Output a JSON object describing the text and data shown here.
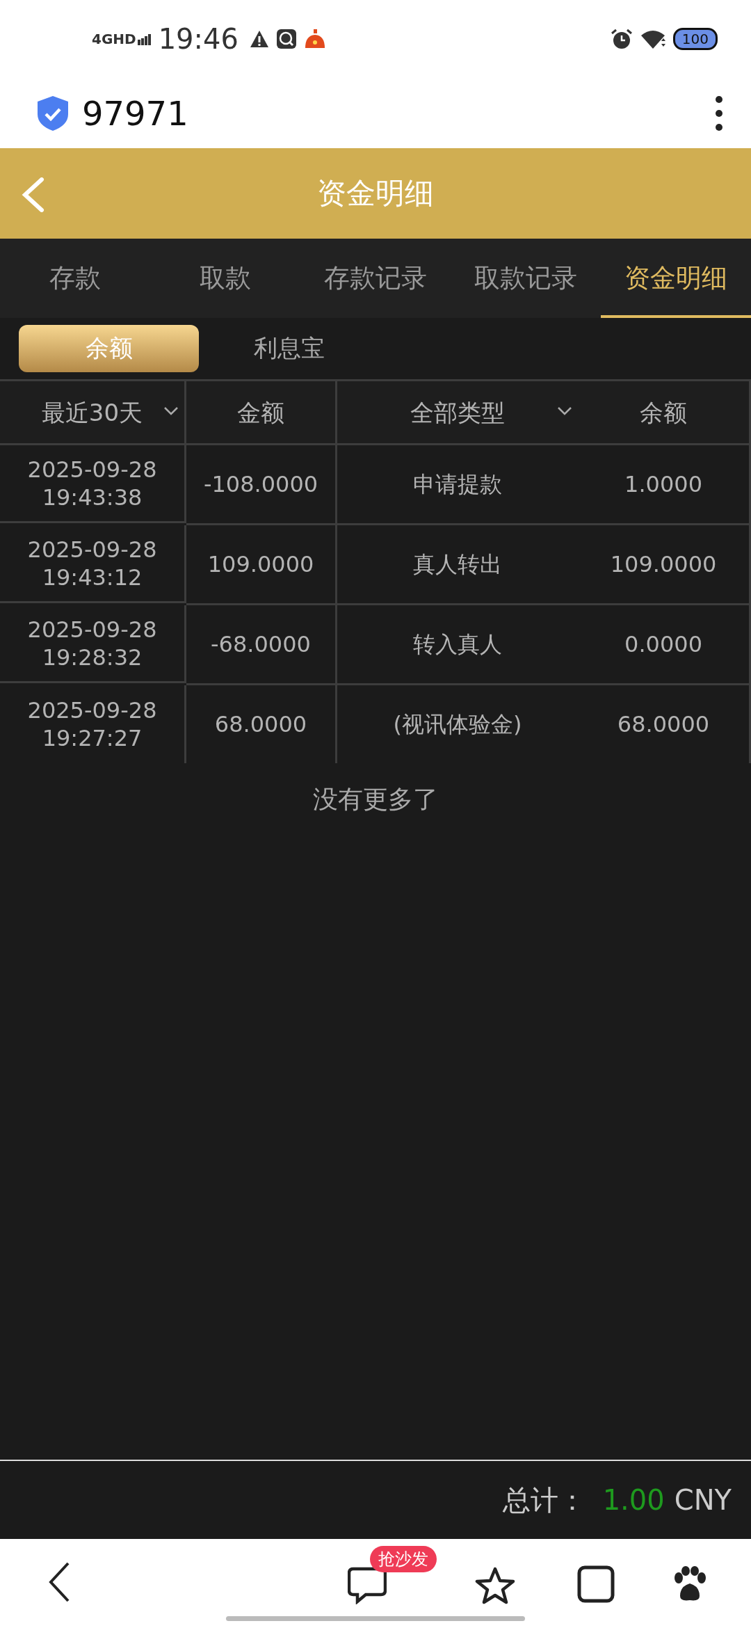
{
  "status_bar": {
    "network": "4GHD",
    "time": "19:46",
    "battery": "100"
  },
  "address_bar": {
    "title": "97971"
  },
  "header": {
    "title": "资金明细"
  },
  "tabs": [
    {
      "label": "存款",
      "selected": false
    },
    {
      "label": "取款",
      "selected": false
    },
    {
      "label": "存款记录",
      "selected": false
    },
    {
      "label": "取款记录",
      "selected": false
    },
    {
      "label": "资金明细",
      "selected": true
    }
  ],
  "sub_tabs": [
    {
      "label": "余额",
      "selected": true
    },
    {
      "label": "利息宝",
      "selected": false
    }
  ],
  "table": {
    "columns": [
      {
        "label": "最近30天",
        "dropdown": true
      },
      {
        "label": "金额",
        "dropdown": false
      },
      {
        "label": "全部类型",
        "dropdown": true
      },
      {
        "label": "余额",
        "dropdown": false
      }
    ],
    "rows": [
      {
        "datetime": "2025-09-28 19:43:38",
        "amount": "-108.0000",
        "type": "申请提款",
        "balance": "1.0000"
      },
      {
        "datetime": "2025-09-28 19:43:12",
        "amount": "109.0000",
        "type": "真人转出",
        "balance": "109.0000"
      },
      {
        "datetime": "2025-09-28 19:28:32",
        "amount": "-68.0000",
        "type": "转入真人",
        "balance": "0.0000"
      },
      {
        "datetime": "2025-09-28 19:27:27",
        "amount": "68.0000",
        "type": "(视讯体验金)",
        "balance": "68.0000"
      }
    ]
  },
  "empty_message": "没有更多了",
  "footer": {
    "label": "总计：",
    "amount": "1.00",
    "currency": "CNY"
  },
  "browser_nav": {
    "badge": "抢沙发"
  }
}
